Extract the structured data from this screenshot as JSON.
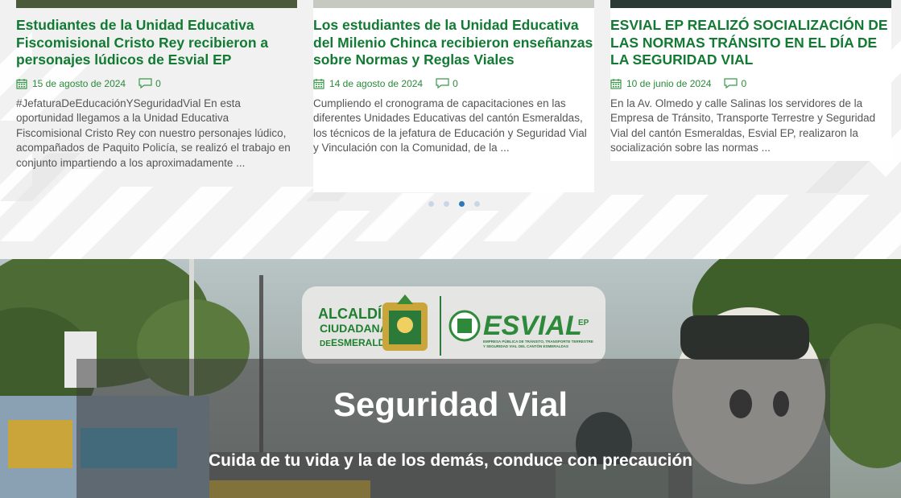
{
  "news": {
    "cards": [
      {
        "title": "Estudiantes de la Unidad Educativa Fiscomisional Cristo Rey recibieron a personajes lúdicos de Esvial EP",
        "date": "15 de agosto de 2024",
        "comments": "0",
        "excerpt": "#JefaturaDeEducaciónYSeguridadVial En esta oportunidad llegamos a la Unidad Educativa Fiscomisional Cristo Rey con nuestro personajes lúdico, acompañados de Paquito Policía, se realizó el trabajo en conjunto impartiendo a los aproximadamente ..."
      },
      {
        "title": "Los estudiantes de la Unidad Educativa del Milenio Chinca recibieron enseñanzas sobre Normas y Reglas Viales",
        "date": "14 de agosto de 2024",
        "comments": "0",
        "excerpt": "Cumpliendo el cronograma de capacitaciones en las diferentes Unidades Educativas del cantón Esmeraldas, los técnicos de la jefatura de Educación y Seguridad Vial y Vinculación con la Comunidad, de la ..."
      },
      {
        "title": "ESVIAL EP REALIZÓ SOCIALIZACIÓN DE LAS NORMAS TRÁNSITO EN EL DÍA DE LA SEGURIDAD VIAL",
        "date": "10 de junio de 2024",
        "comments": "0",
        "excerpt": "En la Av. Olmedo y calle Salinas los servidores de la Empresa de Tránsito, Transporte Terrestre y Seguridad Vial del cantón Esmeraldas, Esvial EP, realizaron la socialización sobre las normas ..."
      }
    ],
    "carousel_active_dot": 3
  },
  "hero": {
    "logo_left": [
      "ALCALDÍA",
      "CIUDADANA",
      "DE",
      "ESMERALDAS"
    ],
    "logo_right": "ESVIAL",
    "logo_right_suffix": "EP",
    "logo_right_tagline_1": "EMPRESA PÚBLICA DE TRÁNSITO, TRANSPORTE TERRESTRE",
    "logo_right_tagline_2": "Y SEGURIDAD VIAL DEL CANTÓN ESMERALDAS",
    "title": "Seguridad Vial",
    "subtitle": "Cuida de tu vida y la de los demás, conduce con precaución"
  },
  "colors": {
    "title_green": "#127a33",
    "meta_green": "#2a8a3a",
    "dot_active": "#2f79b8",
    "dot_inactive": "#c9d7e4"
  },
  "icons": [
    "calendar-icon",
    "comment-icon"
  ]
}
